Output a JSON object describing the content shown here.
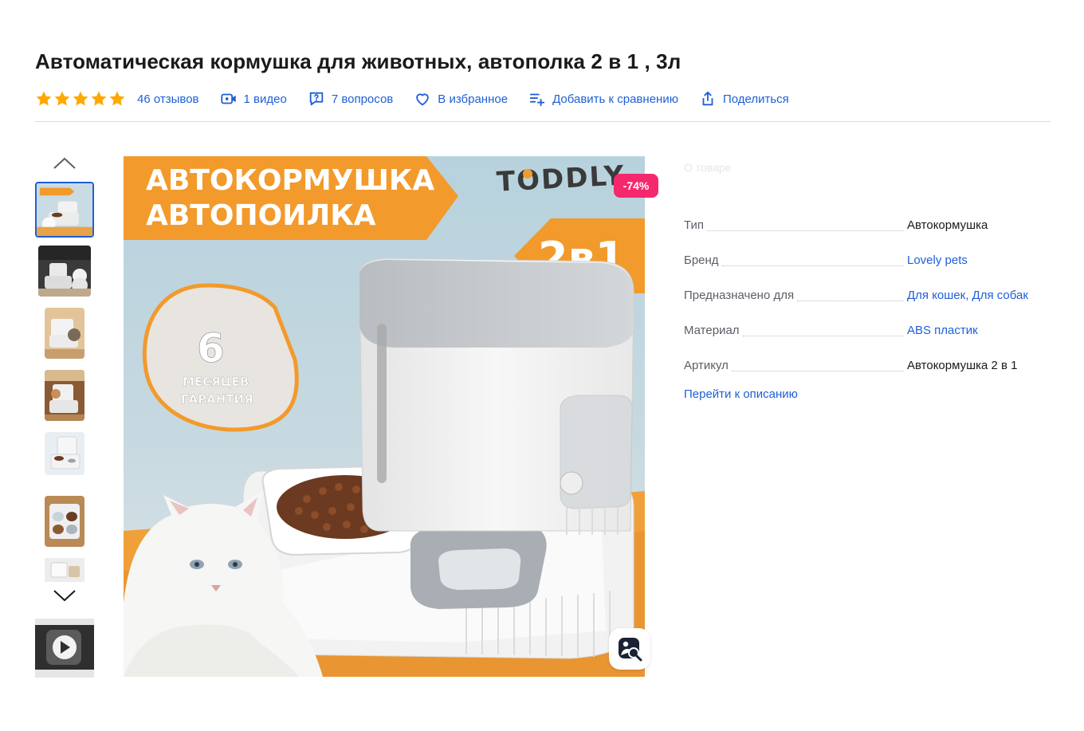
{
  "product": {
    "title": "Автоматическая кормушка для животных, автополка 2 в 1 , 3л",
    "rating_stars": 5
  },
  "meta": {
    "reviews": "46 отзывов",
    "video": "1 видео",
    "questions": "7 вопросов",
    "favorite": "В избранное",
    "compare": "Добавить к сравнению",
    "share": "Поделиться"
  },
  "gallery": {
    "discount_badge": "-74%",
    "image_text": {
      "line1": "АВТОКОРМУШКА",
      "line2": "АВТОПОИЛКА",
      "brand_logo": "TODDLY",
      "badge": "2в1",
      "warranty_number": "6",
      "warranty_line1": "МЕСЯЦЕВ",
      "warranty_line2": "ГАРАНТИЯ"
    },
    "icons": {
      "up": "chevron-up-icon",
      "down": "chevron-down-icon",
      "play": "play-icon",
      "lens": "image-search-icon"
    }
  },
  "specs": {
    "header": "О товаре",
    "rows": [
      {
        "key": "Тип",
        "value": "Автокормушка"
      },
      {
        "key": "Бренд",
        "value": "Lovely pets"
      },
      {
        "key": "Предназначено для",
        "value": "Для кошек, Для собак"
      },
      {
        "key": "Материал",
        "value": "ABS пластик"
      },
      {
        "key": "Артикул",
        "value": "Автокормушка 2 в 1"
      }
    ],
    "go_to_description": "Перейти к описанию"
  },
  "colors": {
    "accent": "#1f5fd6",
    "star": "#ffa900",
    "discount": "#f5286e",
    "banner_orange": "#f29a2c",
    "bg_blue": "#b9d3df"
  }
}
